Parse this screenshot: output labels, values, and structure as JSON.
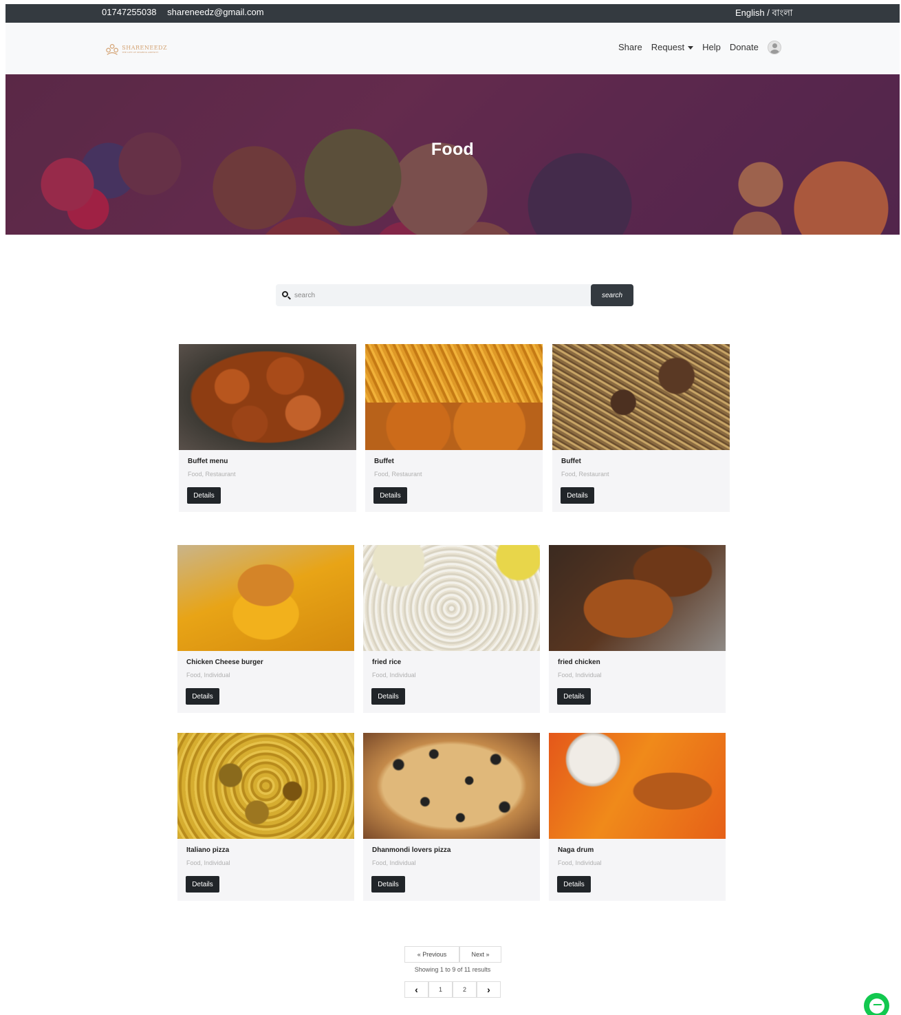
{
  "topbar": {
    "phone": "01747255038",
    "email": "shareneedz@gmail.com",
    "language": "English / বাংলা"
  },
  "navbar": {
    "logo_text": "SHARENEEDZ",
    "logo_tagline": "THE LIFE OF SHARING AMENITY",
    "links": {
      "share": "Share",
      "request": "Request",
      "help": "Help",
      "donate": "Donate"
    }
  },
  "hero": {
    "title": "Food"
  },
  "search": {
    "placeholder": "search",
    "button": "search"
  },
  "cards": [
    {
      "title": "Buffet menu",
      "category": "Food, Restaurant",
      "button": "Details",
      "image": "fried-pakora"
    },
    {
      "title": "Buffet",
      "category": "Food, Restaurant",
      "button": "Details",
      "image": "fries-pakora"
    },
    {
      "title": "Buffet",
      "category": "Food, Restaurant",
      "button": "Details",
      "image": "biryani"
    },
    {
      "title": "Chicken Cheese burger",
      "category": "Food, Individual",
      "button": "Details",
      "image": "burger"
    },
    {
      "title": "fried rice",
      "category": "Food, Individual",
      "button": "Details",
      "image": "fried-rice"
    },
    {
      "title": "fried chicken",
      "category": "Food, Individual",
      "button": "Details",
      "image": "fried-chicken"
    },
    {
      "title": "Italiano pizza",
      "category": "Food, Individual",
      "button": "Details",
      "image": "pizza"
    },
    {
      "title": "Dhanmondi lovers pizza",
      "category": "Food, Individual",
      "button": "Details",
      "image": "olive-pizza"
    },
    {
      "title": "Naga drum",
      "category": "Food, Individual",
      "button": "Details",
      "image": "chicken-drumstick"
    }
  ],
  "pagination": {
    "previous": "« Previous",
    "next": "Next »",
    "showing": "Showing 1 to 9 of 11 results",
    "pages": [
      "1",
      "2"
    ],
    "current_page": 1
  },
  "icons": {
    "search": "search-icon",
    "dropdown": "caret-down-icon",
    "user": "user-avatar-icon",
    "prev": "chevron-left-icon",
    "next": "chevron-right-icon",
    "chat": "messenger-icon"
  },
  "colors": {
    "topbar": "#343a40",
    "navbar": "#f8f9fa",
    "button_dark": "#212529",
    "messenger": "#12c84f"
  }
}
